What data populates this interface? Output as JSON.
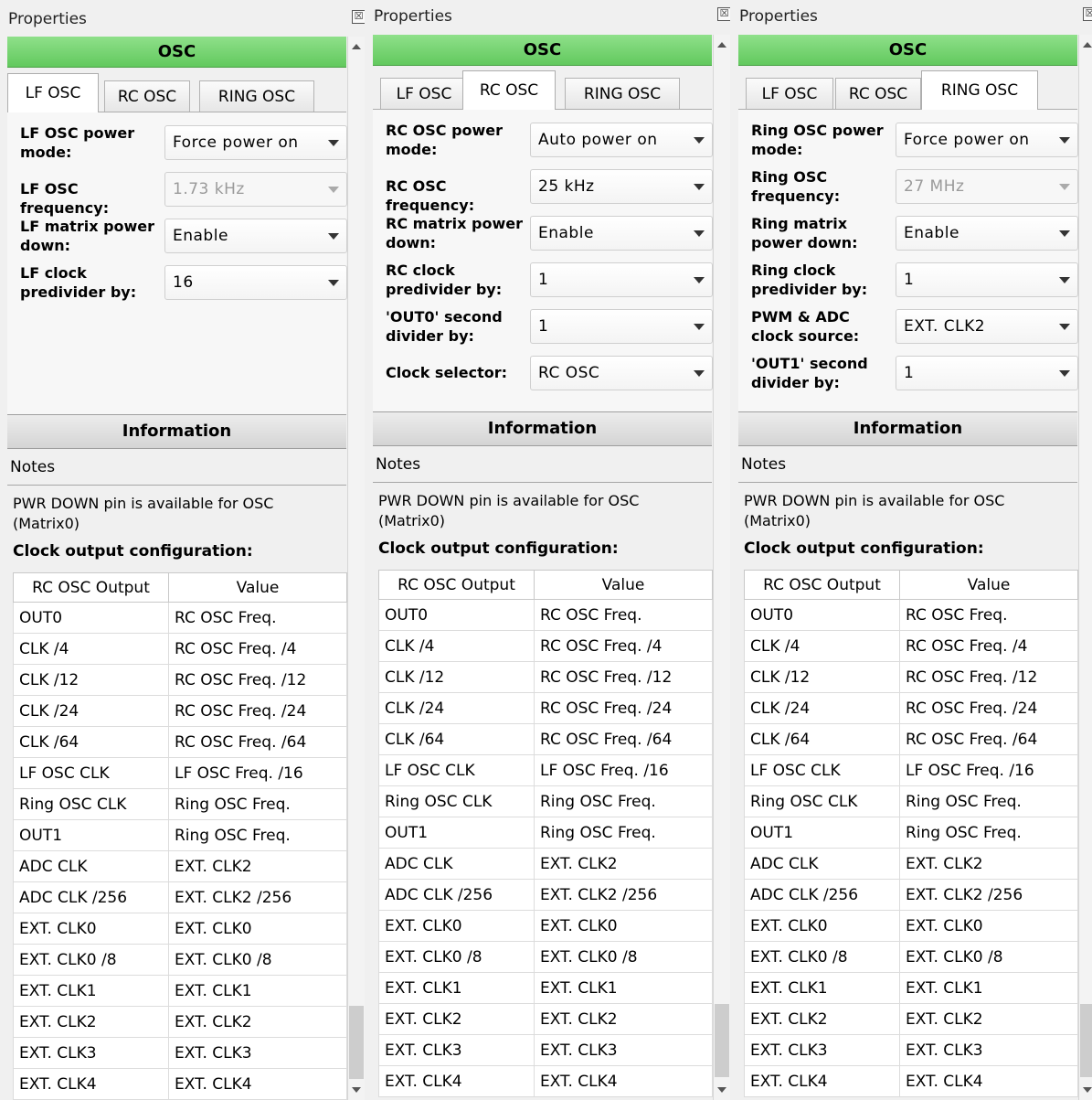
{
  "panels": [
    {
      "title": "Properties",
      "close_glyph": "☒",
      "header": "OSC",
      "tabs": [
        "LF OSC",
        "RC OSC",
        "RING OSC"
      ],
      "active_tab": 0,
      "fields": [
        {
          "label": "LF OSC power mode:",
          "value": "Force power on",
          "disabled": false
        },
        {
          "label": "LF OSC frequency:",
          "value": "1.73 kHz",
          "disabled": true
        },
        {
          "label": "LF matrix power down:",
          "value": "Enable",
          "disabled": false
        },
        {
          "label": "LF clock predivider by:",
          "value": "16",
          "disabled": false
        }
      ],
      "info_header": "Information",
      "notes_label": "Notes",
      "note_text": "PWR DOWN pin is available for OSC (Matrix0)",
      "clock_title": "Clock output configuration:",
      "table_headers": [
        "RC OSC Output",
        "Value"
      ],
      "table_rows": [
        [
          "OUT0",
          "RC OSC Freq."
        ],
        [
          "CLK /4",
          "RC OSC Freq. /4"
        ],
        [
          "CLK /12",
          "RC OSC Freq. /12"
        ],
        [
          "CLK /24",
          "RC OSC Freq. /24"
        ],
        [
          "CLK /64",
          "RC OSC Freq. /64"
        ],
        [
          "LF OSC CLK",
          "LF OSC Freq. /16"
        ],
        [
          "Ring OSC CLK",
          "Ring OSC Freq."
        ],
        [
          "OUT1",
          "Ring OSC Freq."
        ],
        [
          "ADC CLK",
          "EXT. CLK2"
        ],
        [
          "ADC CLK /256",
          "EXT. CLK2 /256"
        ],
        [
          "EXT. CLK0",
          "EXT. CLK0"
        ],
        [
          "EXT. CLK0 /8",
          "EXT. CLK0 /8"
        ],
        [
          "EXT. CLK1",
          "EXT. CLK1"
        ],
        [
          "EXT. CLK2",
          "EXT. CLK2"
        ],
        [
          "EXT. CLK3",
          "EXT. CLK3"
        ],
        [
          "EXT. CLK4",
          "EXT. CLK4"
        ]
      ]
    },
    {
      "title": "Properties",
      "close_glyph": "☒",
      "header": "OSC",
      "tabs": [
        "LF OSC",
        "RC OSC",
        "RING OSC"
      ],
      "active_tab": 1,
      "fields": [
        {
          "label": "RC OSC power mode:",
          "value": "Auto power on",
          "disabled": false
        },
        {
          "label": "RC OSC frequency:",
          "value": "25 kHz",
          "disabled": false
        },
        {
          "label": "RC matrix power down:",
          "value": "Enable",
          "disabled": false
        },
        {
          "label": "RC clock predivider by:",
          "value": "1",
          "disabled": false
        },
        {
          "label": "'OUT0' second divider by:",
          "value": "1",
          "disabled": false
        },
        {
          "label": "Clock selector:",
          "value": "RC OSC",
          "disabled": false
        }
      ],
      "info_header": "Information",
      "notes_label": "Notes",
      "note_text": "PWR DOWN pin is available for OSC (Matrix0)",
      "clock_title": "Clock output configuration:",
      "table_headers": [
        "RC OSC Output",
        "Value"
      ],
      "table_rows": [
        [
          "OUT0",
          "RC OSC Freq."
        ],
        [
          "CLK /4",
          "RC OSC Freq. /4"
        ],
        [
          "CLK /12",
          "RC OSC Freq. /12"
        ],
        [
          "CLK /24",
          "RC OSC Freq. /24"
        ],
        [
          "CLK /64",
          "RC OSC Freq. /64"
        ],
        [
          "LF OSC CLK",
          "LF OSC Freq. /16"
        ],
        [
          "Ring OSC CLK",
          "Ring OSC Freq."
        ],
        [
          "OUT1",
          "Ring OSC Freq."
        ],
        [
          "ADC CLK",
          "EXT. CLK2"
        ],
        [
          "ADC CLK /256",
          "EXT. CLK2 /256"
        ],
        [
          "EXT. CLK0",
          "EXT. CLK0"
        ],
        [
          "EXT. CLK0 /8",
          "EXT. CLK0 /8"
        ],
        [
          "EXT. CLK1",
          "EXT. CLK1"
        ],
        [
          "EXT. CLK2",
          "EXT. CLK2"
        ],
        [
          "EXT. CLK3",
          "EXT. CLK3"
        ],
        [
          "EXT. CLK4",
          "EXT. CLK4"
        ]
      ]
    },
    {
      "title": "Properties",
      "close_glyph": "☒",
      "header": "OSC",
      "tabs": [
        "LF OSC",
        "RC OSC",
        "RING OSC"
      ],
      "active_tab": 2,
      "fields": [
        {
          "label": "Ring OSC power mode:",
          "value": "Force power on",
          "disabled": false
        },
        {
          "label": "Ring OSC frequency:",
          "value": "27 MHz",
          "disabled": true
        },
        {
          "label": "Ring matrix power down:",
          "value": "Enable",
          "disabled": false
        },
        {
          "label": "Ring clock predivider by:",
          "value": "1",
          "disabled": false
        },
        {
          "label": "PWM & ADC clock source:",
          "value": "EXT. CLK2",
          "disabled": false
        },
        {
          "label": "'OUT1' second divider by:",
          "value": "1",
          "disabled": false
        }
      ],
      "info_header": "Information",
      "notes_label": "Notes",
      "note_text": "PWR DOWN pin is available for OSC (Matrix0)",
      "clock_title": "Clock output configuration:",
      "table_headers": [
        "RC OSC Output",
        "Value"
      ],
      "table_rows": [
        [
          "OUT0",
          "RC OSC Freq."
        ],
        [
          "CLK /4",
          "RC OSC Freq. /4"
        ],
        [
          "CLK /12",
          "RC OSC Freq. /12"
        ],
        [
          "CLK /24",
          "RC OSC Freq. /24"
        ],
        [
          "CLK /64",
          "RC OSC Freq. /64"
        ],
        [
          "LF OSC CLK",
          "LF OSC Freq. /16"
        ],
        [
          "Ring OSC CLK",
          "Ring OSC Freq."
        ],
        [
          "OUT1",
          "Ring OSC Freq."
        ],
        [
          "ADC CLK",
          "EXT. CLK2"
        ],
        [
          "ADC CLK /256",
          "EXT. CLK2 /256"
        ],
        [
          "EXT. CLK0",
          "EXT. CLK0"
        ],
        [
          "EXT. CLK0 /8",
          "EXT. CLK0 /8"
        ],
        [
          "EXT. CLK1",
          "EXT. CLK1"
        ],
        [
          "EXT. CLK2",
          "EXT. CLK2"
        ],
        [
          "EXT. CLK3",
          "EXT. CLK3"
        ],
        [
          "EXT. CLK4",
          "EXT. CLK4"
        ]
      ]
    }
  ]
}
